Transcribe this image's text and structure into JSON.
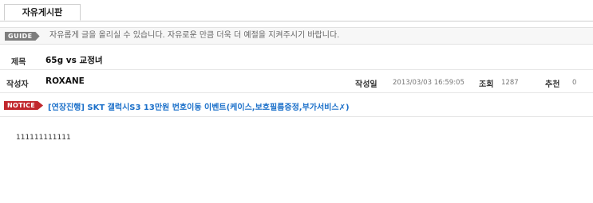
{
  "tab": {
    "label": "자유게시판"
  },
  "guide": {
    "badge": "GUIDE",
    "text": "자유롭게 글을 올리실 수 있습니다. 자유로운 만큼 더욱 더 예절을 지켜주시기 바랍니다."
  },
  "post": {
    "title_label": "제목",
    "title": "65g vs 교정녀",
    "author_label": "작성자",
    "author": "ROXANE",
    "date_label": "작성일",
    "date": "2013/03/03 16:59:05",
    "views_label": "조회",
    "views": "1287",
    "recommend_label": "추천",
    "recommend": "0",
    "content": "111111111111"
  },
  "notice": {
    "badge": "NOTICE",
    "text": "[연장진행] SKT 갤럭시S3 13만원 번호이동 이벤트(케이스,보호필름증정,부가서비스✗)"
  },
  "colors": {
    "notice_red": "#c1272d",
    "link_blue": "#1a6fc9",
    "guide_gray": "#7d7d7d"
  }
}
